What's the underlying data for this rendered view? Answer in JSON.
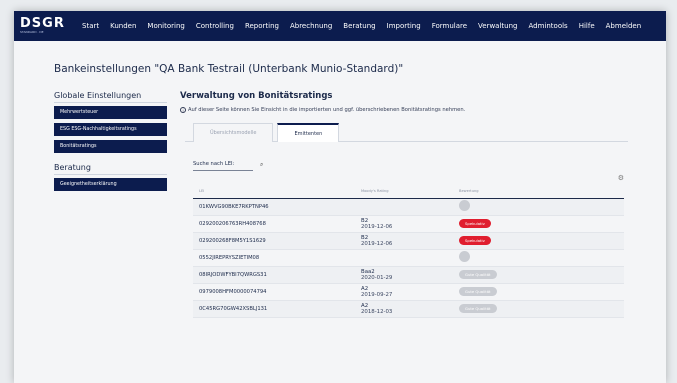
{
  "nav": {
    "logo": "DSGR",
    "logo_sub": "STANDARD · DE",
    "items": [
      "Start",
      "Kunden",
      "Monitoring",
      "Controlling",
      "Reporting",
      "Abrechnung",
      "Beratung",
      "Importing",
      "Formulare",
      "Verwaltung",
      "Admintools",
      "Hilfe",
      "Abmelden"
    ]
  },
  "page": {
    "title": "Bankeinstellungen \"QA Bank Testrail (Unterbank Munio-Standard)\""
  },
  "sidebar": {
    "group1": "Globale Einstellungen",
    "items1": [
      "Mehrwertsteuer",
      "ESG ESG-Nachhaltigkeitsratings",
      "Bonitätsratings"
    ],
    "group2": "Beratung",
    "items2": [
      "Geeignetheitserklärung"
    ]
  },
  "main": {
    "title": "Verwaltung von Bonitätsratings",
    "info": "Auf dieser Seite können Sie Einsicht in die importierten und ggf. überschriebenen Bonitätsratings nehmen.",
    "tabs": [
      "Übersichtsmodelle",
      "Emittenten"
    ],
    "search_label": "Suche nach LEI:",
    "columns": [
      "LEI",
      "Moody's Rating",
      "Bewertung"
    ],
    "rows": [
      {
        "lei": "01KWVG90BKE7RKPTNP46",
        "code": "",
        "date": "",
        "badge": "",
        "badge_type": "dot"
      },
      {
        "lei": "029200206763RH408768",
        "code": "B2",
        "date": "2019-12-06",
        "badge": "Spekulativ",
        "badge_type": "red"
      },
      {
        "lei": "029200268F8M5Y1S1629",
        "code": "B2",
        "date": "2019-12-06",
        "badge": "Spekulativ",
        "badge_type": "red"
      },
      {
        "lei": "0552JIREPRYSZIETIM08",
        "code": "",
        "date": "",
        "badge": "",
        "badge_type": "dot"
      },
      {
        "lei": "08IRJODWFYBI7QWRGS31",
        "code": "Baa2",
        "date": "2020-01-29",
        "badge": "Gute Qualität",
        "badge_type": "grey"
      },
      {
        "lei": "0979008HFM0000074794",
        "code": "A2",
        "date": "2019-09-27",
        "badge": "Gute Qualität",
        "badge_type": "grey"
      },
      {
        "lei": "0C45RG70GW42XSBLJ131",
        "code": "A2",
        "date": "2018-12-03",
        "badge": "Gute Qualität",
        "badge_type": "grey"
      }
    ]
  },
  "colors": {
    "navbar": "#0c1c4e",
    "badge_red": "#e01e2f",
    "badge_grey": "#c9ccd2"
  },
  "icons": {
    "info": "info-circle-icon",
    "search": "search-icon",
    "settings": "gear-icon"
  }
}
